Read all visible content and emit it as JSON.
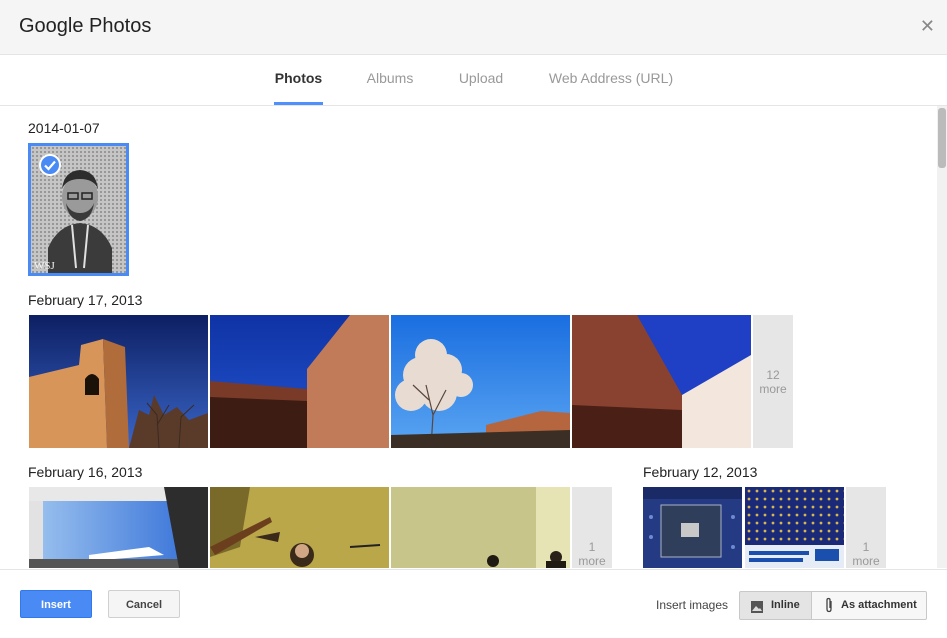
{
  "dialog": {
    "title": "Google Photos"
  },
  "tabs": [
    "Photos",
    "Albums",
    "Upload",
    "Web Address (URL)"
  ],
  "groups": [
    {
      "date": "2014-01-07"
    },
    {
      "date": "February 17, 2013",
      "more": "12\nmore"
    },
    {
      "date": "February 16, 2013",
      "more": "1\nmore"
    },
    {
      "date": "February 12, 2013",
      "more": "1\nmore"
    }
  ],
  "footer": {
    "insert": "Insert",
    "cancel": "Cancel",
    "insert_images_label": "Insert images",
    "inline": "Inline",
    "attachment": "As attachment"
  },
  "colors": {
    "accent": "#4d90fe",
    "insert_button": "#4a8af4",
    "more_tile": "#e6e6e6"
  },
  "icons": [
    "close-icon",
    "checkmark-icon",
    "image-icon",
    "paperclip-icon"
  ]
}
